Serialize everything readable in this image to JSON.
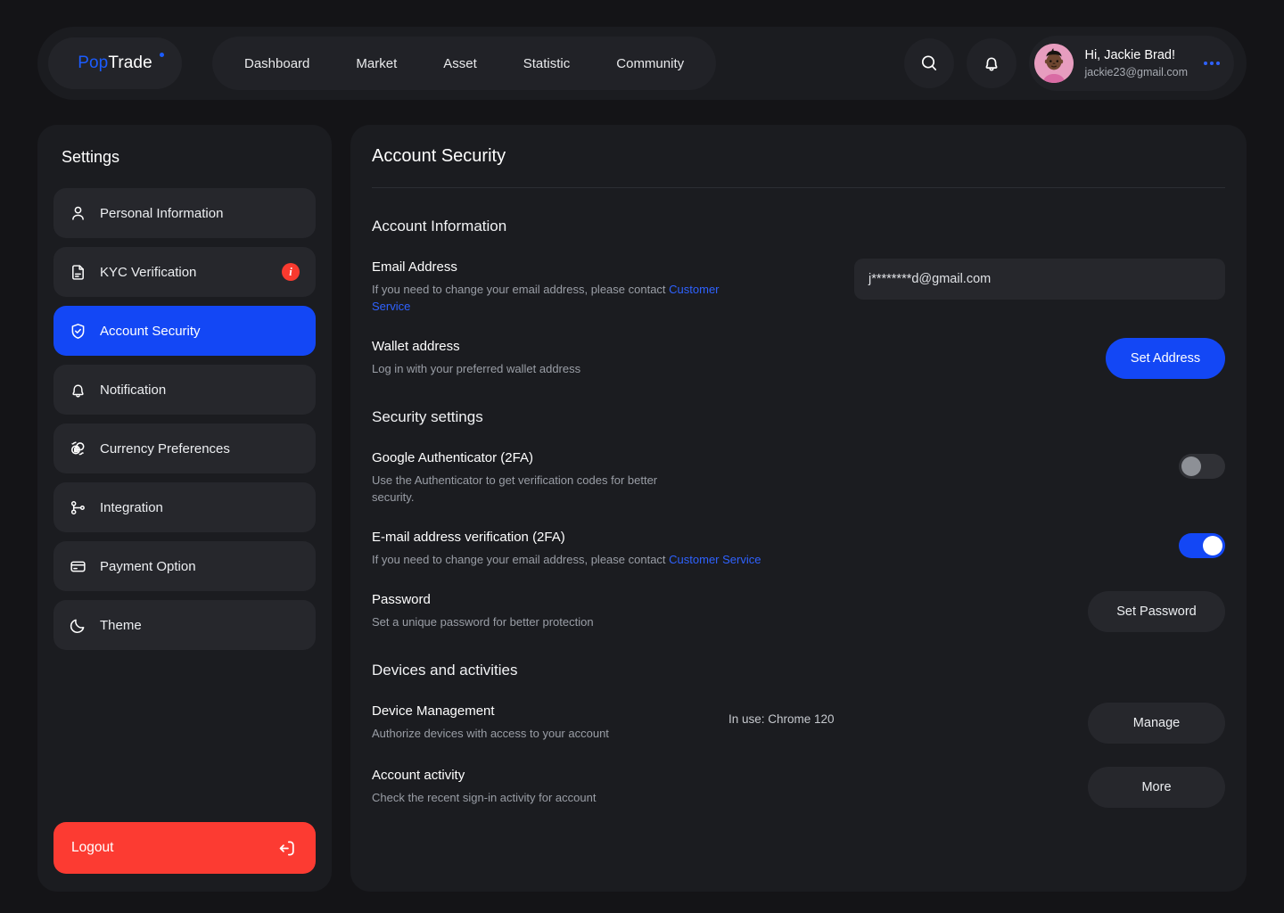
{
  "brand": {
    "name_accent": "Pop",
    "name_rest": "Trade"
  },
  "nav": {
    "items": [
      {
        "label": "Dashboard"
      },
      {
        "label": "Market"
      },
      {
        "label": "Asset"
      },
      {
        "label": "Statistic"
      },
      {
        "label": "Community"
      }
    ]
  },
  "profile": {
    "greeting": "Hi, Jackie Brad!",
    "email": "jackie23@gmail.com"
  },
  "sidebar": {
    "title": "Settings",
    "items": [
      {
        "label": "Personal Information",
        "icon": "user-icon",
        "active": false,
        "badge": ""
      },
      {
        "label": "KYC Verification",
        "icon": "document-icon",
        "active": false,
        "badge": "i"
      },
      {
        "label": "Account Security",
        "icon": "shield-check-icon",
        "active": true,
        "badge": ""
      },
      {
        "label": "Notification",
        "icon": "bell-icon",
        "active": false,
        "badge": ""
      },
      {
        "label": "Currency Preferences",
        "icon": "currency-exchange-icon",
        "active": false,
        "badge": ""
      },
      {
        "label": "Integration",
        "icon": "integration-node-icon",
        "active": false,
        "badge": ""
      },
      {
        "label": "Payment Option",
        "icon": "credit-card-icon",
        "active": false,
        "badge": ""
      },
      {
        "label": "Theme",
        "icon": "moon-icon",
        "active": false,
        "badge": ""
      }
    ],
    "logout_label": "Logout"
  },
  "main": {
    "page_title": "Account Security",
    "account_information": {
      "section_title": "Account Information",
      "email_row": {
        "title": "Email Address",
        "desc_part1": "If you need to change your email address, please contact ",
        "desc_link": "Customer Service",
        "value": "j********d@gmail.com"
      },
      "wallet_row": {
        "title": "Wallet address",
        "desc": "Log in with your preferred wallet address",
        "button": "Set Address"
      }
    },
    "security_settings": {
      "section_title": "Security settings",
      "authenticator_row": {
        "title": "Google Authenticator (2FA)",
        "desc": "Use the Authenticator to get verification codes for better security.",
        "toggle_state": "off"
      },
      "email_verification_row": {
        "title": "E-mail address verification (2FA)",
        "desc_part1": "If you need to change your email address, please contact ",
        "desc_link": "Customer Service",
        "toggle_state": "on"
      },
      "password_row": {
        "title": "Password",
        "desc": "Set a unique password for better protection",
        "button": "Set Password"
      }
    },
    "devices_and_activities": {
      "section_title": "Devices and activities",
      "device_row": {
        "title": "Device Management",
        "desc": "Authorize devices with access to your account",
        "status": "In use: Chrome 120",
        "button": "Manage"
      },
      "activity_row": {
        "title": "Account activity",
        "desc": "Check the recent sign-in activity for account",
        "button": "More"
      }
    }
  },
  "colors": {
    "accent_blue": "#1347f5",
    "link_blue": "#2f62ff",
    "danger_red": "#fc3b32",
    "page_bg": "#141417",
    "card_bg": "#1b1c20",
    "item_bg": "#26272c"
  }
}
